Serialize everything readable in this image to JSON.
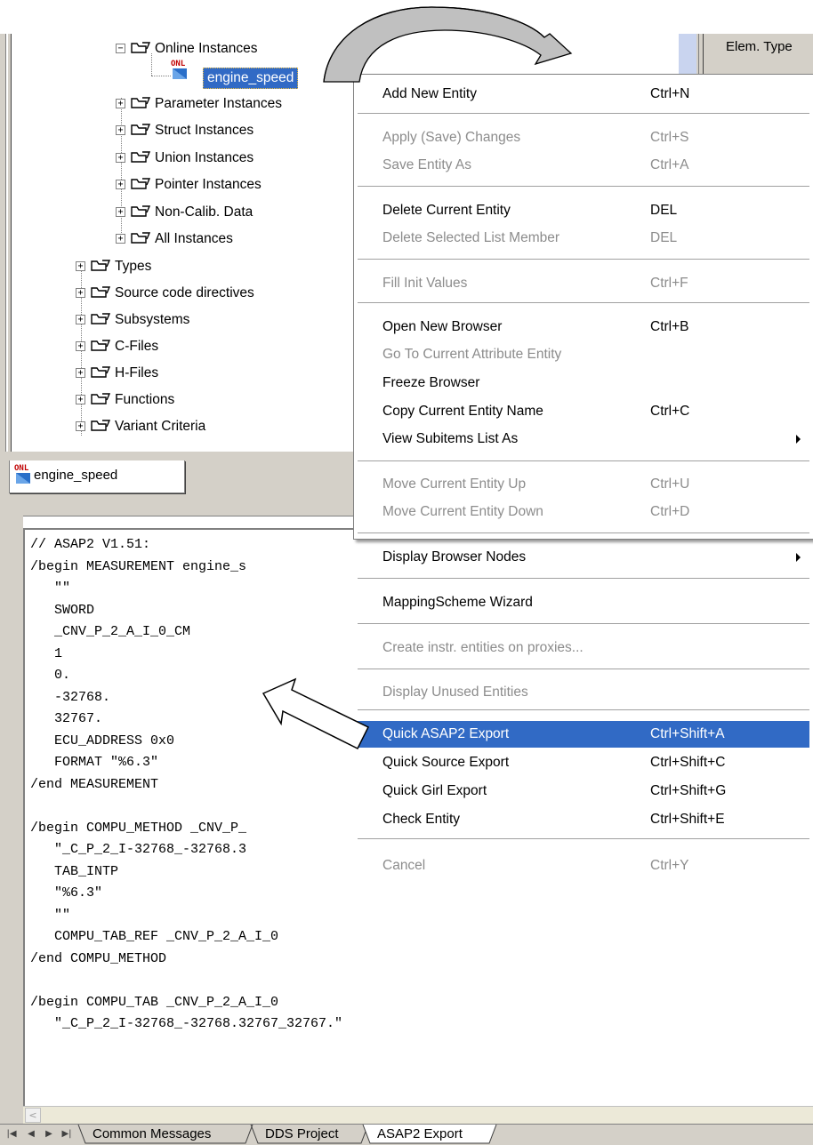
{
  "tree": {
    "items": [
      {
        "label": "Online Instances",
        "expander": "−"
      },
      {
        "label": "engine_speed",
        "badge": "ONL"
      },
      {
        "label": "Parameter Instances",
        "expander": "+"
      },
      {
        "label": "Struct Instances",
        "expander": "+"
      },
      {
        "label": "Union Instances",
        "expander": "+"
      },
      {
        "label": "Pointer Instances",
        "expander": "+"
      },
      {
        "label": "Non-Calib. Data",
        "expander": "+"
      },
      {
        "label": "All Instances",
        "expander": "+"
      },
      {
        "label": "Types",
        "expander": "+"
      },
      {
        "label": "Source code directives",
        "expander": "+"
      },
      {
        "label": "Subsystems",
        "expander": "+"
      },
      {
        "label": "C-Files",
        "expander": "+"
      },
      {
        "label": "H-Files",
        "expander": "+"
      },
      {
        "label": "Functions",
        "expander": "+"
      },
      {
        "label": "Variant Criteria",
        "expander": "+"
      }
    ]
  },
  "right_panel": {
    "label": "Elem. Type"
  },
  "tab": {
    "badge": "ONL",
    "label": "engine_speed"
  },
  "code": {
    "lines": [
      "// ASAP2 V1.51:",
      "/begin MEASUREMENT engine_s",
      "   \"\"",
      "   SWORD",
      "   _CNV_P_2_A_I_0_CM",
      "   1",
      "   0.",
      "   -32768.",
      "   32767.",
      "   ECU_ADDRESS 0x0",
      "   FORMAT \"%6.3\"",
      "/end MEASUREMENT",
      "",
      "/begin COMPU_METHOD _CNV_P_",
      "   \"_C_P_2_I-32768_-32768.3",
      "   TAB_INTP",
      "   \"%6.3\"",
      "   \"\"",
      "   COMPU_TAB_REF _CNV_P_2_A_I_0",
      "/end COMPU_METHOD",
      "",
      "/begin COMPU_TAB _CNV_P_2_A_I_0",
      "   \"_C_P_2_I-32768_-32768.32767_32767.\""
    ]
  },
  "context_menu": {
    "items": [
      {
        "label": "Add New Entity",
        "shortcut": "Ctrl+N",
        "disabled": false
      },
      {
        "label": "Apply (Save) Changes",
        "shortcut": "Ctrl+S",
        "disabled": true
      },
      {
        "label": "Save Entity As",
        "shortcut": "Ctrl+A",
        "disabled": true
      },
      {
        "label": "Delete Current Entity",
        "shortcut": "DEL",
        "disabled": false
      },
      {
        "label": "Delete Selected List Member",
        "shortcut": "DEL",
        "disabled": true
      },
      {
        "label": "Fill Init Values",
        "shortcut": "Ctrl+F",
        "disabled": true
      },
      {
        "label": "Open New Browser",
        "shortcut": "Ctrl+B",
        "disabled": false
      },
      {
        "label": "Go To Current Attribute Entity",
        "shortcut": "",
        "disabled": true
      },
      {
        "label": "Freeze Browser",
        "shortcut": "",
        "disabled": false
      },
      {
        "label": "Copy Current Entity Name",
        "shortcut": "Ctrl+C",
        "disabled": false
      },
      {
        "label": "View Subitems List As",
        "shortcut": "",
        "disabled": false
      },
      {
        "label": "Move Current Entity Up",
        "shortcut": "Ctrl+U",
        "disabled": true
      },
      {
        "label": "Move Current Entity Down",
        "shortcut": "Ctrl+D",
        "disabled": true
      },
      {
        "label": "Display Browser Nodes",
        "shortcut": "",
        "disabled": false
      },
      {
        "label": "MappingScheme Wizard",
        "shortcut": "",
        "disabled": false
      },
      {
        "label": "Create instr. entities on proxies...",
        "shortcut": "",
        "disabled": true
      },
      {
        "label": "Display Unused Entities",
        "shortcut": "",
        "disabled": true
      },
      {
        "label": "Quick ASAP2 Export",
        "shortcut": "Ctrl+Shift+A",
        "disabled": false,
        "selected": true
      },
      {
        "label": "Quick Source Export",
        "shortcut": "Ctrl+Shift+C",
        "disabled": false
      },
      {
        "label": "Quick Girl Export",
        "shortcut": "Ctrl+Shift+G",
        "disabled": false
      },
      {
        "label": "Check Entity",
        "shortcut": "Ctrl+Shift+E",
        "disabled": false
      },
      {
        "label": "Cancel",
        "shortcut": "Ctrl+Y",
        "disabled": true
      }
    ]
  },
  "bottom_tabs": [
    {
      "label": "Common Messages"
    },
    {
      "label": "DDS Project"
    },
    {
      "label": "ASAP2 Export",
      "active": true
    }
  ],
  "colors": {
    "selection": "#316ac5",
    "disabled_text": "#8c8c8c",
    "chrome": "#d4d0c8"
  }
}
